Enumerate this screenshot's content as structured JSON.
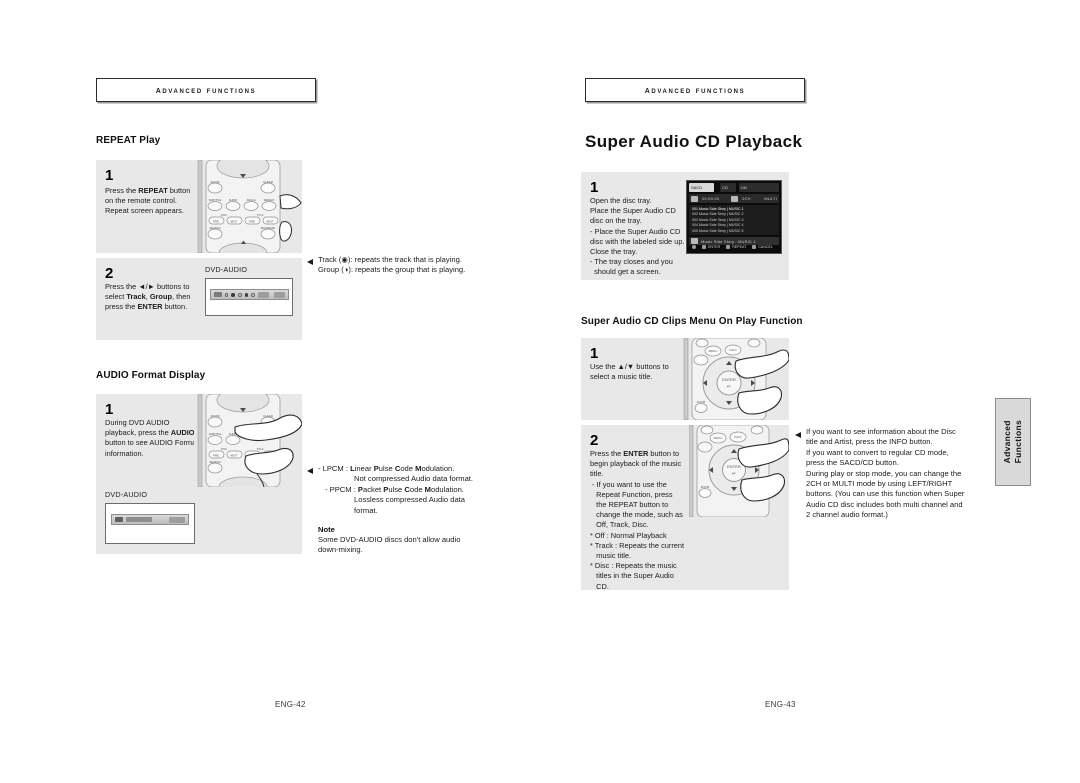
{
  "document": {
    "type": "dvd-player-user-manual-spread",
    "side_tab": {
      "line1": "Advanced",
      "line2": "Functions"
    }
  },
  "left_page": {
    "running_header": "Advanced Functions",
    "page_number": "ENG-42",
    "sections": [
      {
        "title": "REPEAT Play",
        "steps": [
          {
            "number": "1",
            "text_lines": [
              "Press the REPEAT button",
              "on the remote control.",
              "Repeat screen appears."
            ],
            "bold_terms": [
              "REPEAT"
            ]
          },
          {
            "number": "2",
            "text_lines": [
              "Press the ◄/► buttons to",
              "select Track, Group, then",
              "press the ENTER button."
            ],
            "bold_terms": [
              "Track",
              "Group",
              "ENTER"
            ],
            "osd_label": "DVD-AUDIO"
          }
        ],
        "callouts": [
          {
            "has_arrow": true,
            "lines": [
              "Track (◉): repeats the track that is playing.",
              "Group (◕): repeats the group that is playing."
            ]
          }
        ]
      },
      {
        "title": "AUDIO Format Display",
        "steps": [
          {
            "number": "1",
            "text_lines": [
              "During DVD AUDIO",
              "playback, press the AUDIO",
              "button to see AUDIO Format",
              "information."
            ],
            "bold_terms": [
              "AUDIO"
            ],
            "osd_label": "DVD-AUDIO"
          }
        ],
        "callouts": [
          {
            "has_arrow": true,
            "lines": [
              "- LPCM : Linear Pulse Code Modulation.",
              "Not compressed Audio data format.",
              "- PPCM : Packet Pulse Code Modulation.",
              "Lossless compressed Audio data",
              "format."
            ]
          }
        ],
        "note": {
          "heading": "Note",
          "lines": [
            "Some DVD-AUDIO discs don't allow audio",
            "down-mixing."
          ]
        }
      }
    ]
  },
  "right_page": {
    "running_header": "Advanced Functions",
    "page_number": "ENG-43",
    "main_title": "Super Audio CD Playback",
    "sections": [
      {
        "title": "",
        "steps": [
          {
            "number": "1",
            "text_lines": [
              "Open the disc tray.",
              "Place the Super Audio CD",
              "disc on the tray.",
              "- Place the Super Audio CD",
              "disc with the labeled side up.",
              "Close the tray.",
              "- The tray closes and you",
              "  should get a screen."
            ]
          }
        ]
      },
      {
        "title": "Super Audio CD Clips Menu On Play Function",
        "steps": [
          {
            "number": "1",
            "text_lines": [
              "Use the ▲/▼ buttons to",
              "select a music title."
            ]
          },
          {
            "number": "2",
            "text_lines": [
              "Press the ENTER button to",
              "begin playback of the music",
              "title.",
              "- If you want to use the",
              "  Repeat Function, press",
              "  the REPEAT button to",
              "  change the mode, such as",
              "  Off, Track, Disc.",
              "* Off : Normal Playback",
              "* Track : Repeats the current",
              "  music title.",
              "* Disc : Repeats the music",
              "  titles in the Super Audio",
              "  CD."
            ],
            "bold_terms": [
              "ENTER"
            ]
          }
        ],
        "callouts": [
          {
            "has_arrow": true,
            "lines": [
              "If you want to see information about the Disc",
              "title and Artist, press the INFO button.",
              "If you want to convert to regular CD mode,",
              "press the SACD/CD button.",
              "During play or stop mode, you can change the",
              "2CH or MULTI mode by using LEFT/RIGHT",
              "buttons. (You can use this function when Super",
              "Audio CD disc includes both multi channel and",
              "2 channel audio format.)"
            ]
          }
        ]
      }
    ],
    "sacd_screen": {
      "tag_left": "SACD",
      "tag_mid": "CD",
      "tag_right": "ON",
      "row2_time": "00:00:20",
      "row2_ch": "2CH",
      "row2_mode": "MULTI",
      "list": [
        "001 Music Side Story  |  MUSIC 1",
        "002 Music Side Story  |  MUSIC 2",
        "003 Music Side Story  |  MUSIC 3",
        "004 Music Side Story  |  MUSIC 4",
        "005 Music Side Story  |  MUSIC 5"
      ],
      "now_playing": "Music Side Story  :  MUSIC 1",
      "buttons": [
        "ENTER",
        "REPEAT",
        "CANCEL"
      ]
    }
  },
  "remote_buttons": {
    "group_a": [
      "ZOOM",
      "CLEAR"
    ],
    "group_b": [
      "SUBTITLE",
      "AUDIO",
      "ANGLE",
      "REPEAT"
    ],
    "group_c_left_label": "DISC",
    "group_c_right_label": "TITLE",
    "group_c": [
      "PREV",
      "NEXT",
      "PREV",
      "NEXT"
    ],
    "group_d": [
      "SEARCH",
      "BOOKMARK"
    ],
    "dpad_center": "ENTER",
    "top_row": [
      "MENU",
      "INFO",
      "PLAY"
    ]
  }
}
